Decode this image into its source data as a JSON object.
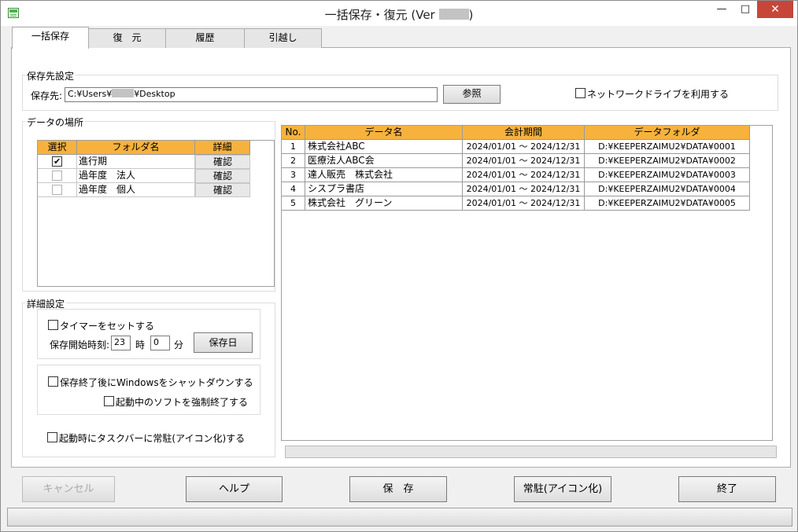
{
  "window": {
    "title_prefix": "一括保存・復元 (Ver",
    "title_suffix": ")",
    "minimize": "—",
    "maximize": "□",
    "close": "✕"
  },
  "tabs": [
    "一括保存",
    "復　元",
    "履歴",
    "引越し"
  ],
  "save_destination": {
    "group_title": "保存先設定",
    "label": "保存先:",
    "path_prefix": "C:¥Users¥",
    "path_suffix": "¥Desktop",
    "browse_button": "参照",
    "network_drive_label": "ネットワークドライブを利用する",
    "network_drive_checked": false
  },
  "data_location": {
    "group_title": "データの場所",
    "headers": [
      "選択",
      "フォルダ名",
      "詳細"
    ],
    "rows": [
      {
        "checked": true,
        "folder": "進行期",
        "detail": "確認"
      },
      {
        "checked": false,
        "folder": "過年度　法人",
        "detail": "確認"
      },
      {
        "checked": false,
        "folder": "過年度　個人",
        "detail": "確認"
      }
    ]
  },
  "details": {
    "group_title": "詳細設定",
    "timer_label": "タイマーをセットする",
    "timer_checked": false,
    "start_time_label": "保存開始時刻:",
    "hour_value": "23",
    "hour_unit": "時",
    "minute_value": "0",
    "minute_unit": "分",
    "save_day_button": "保存日",
    "shutdown_label": "保存終了後にWindowsをシャットダウンする",
    "shutdown_checked": false,
    "force_quit_label": "起動中のソフトを強制終了する",
    "force_quit_checked": false,
    "resident_label": "起動時にタスクバーに常駐(アイコン化)する",
    "resident_checked": false
  },
  "data_table": {
    "headers": [
      "No.",
      "データ名",
      "会計期間",
      "データフォルダ"
    ],
    "rows": [
      {
        "no": "1",
        "name": "株式会社ABC",
        "period": "2024/01/01 ～ 2024/12/31",
        "folder": "D:¥KEEPERZAIMU2¥DATA¥0001"
      },
      {
        "no": "2",
        "name": "医療法人ABC会",
        "period": "2024/01/01 ～ 2024/12/31",
        "folder": "D:¥KEEPERZAIMU2¥DATA¥0002"
      },
      {
        "no": "3",
        "name": "達人販売　株式会社",
        "period": "2024/01/01 ～ 2024/12/31",
        "folder": "D:¥KEEPERZAIMU2¥DATA¥0003"
      },
      {
        "no": "4",
        "name": "シスプラ書店",
        "period": "2024/01/01 ～ 2024/12/31",
        "folder": "D:¥KEEPERZAIMU2¥DATA¥0004"
      },
      {
        "no": "5",
        "name": "株式会社　グリーン",
        "period": "2024/01/01 ～ 2024/12/31",
        "folder": "D:¥KEEPERZAIMU2¥DATA¥0005"
      }
    ]
  },
  "buttons": {
    "cancel": "キャンセル",
    "help": "ヘルプ",
    "save": "保　存",
    "resident": "常駐(アイコン化)",
    "exit": "終了"
  }
}
